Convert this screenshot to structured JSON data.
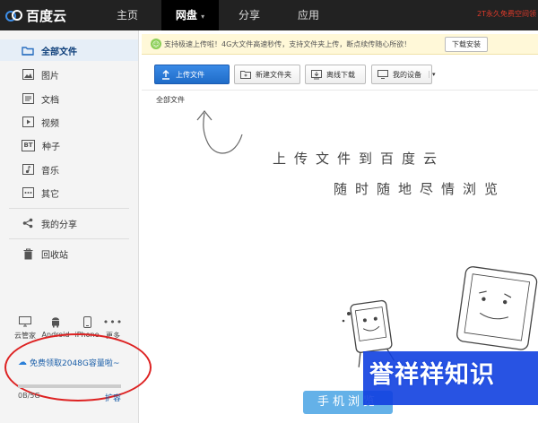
{
  "header": {
    "logo_text": "百度云",
    "nav": [
      {
        "label": "主页"
      },
      {
        "label": "网盘"
      },
      {
        "label": "分享"
      },
      {
        "label": "应用"
      }
    ],
    "promo": "2T永久免费空间领"
  },
  "sidebar": {
    "items": [
      {
        "label": "全部文件",
        "icon": "folder-icon"
      },
      {
        "label": "图片",
        "icon": "image-icon"
      },
      {
        "label": "文档",
        "icon": "document-icon"
      },
      {
        "label": "视频",
        "icon": "video-icon"
      },
      {
        "label": "种子",
        "icon": "bt-icon"
      },
      {
        "label": "音乐",
        "icon": "music-icon"
      },
      {
        "label": "其它",
        "icon": "more-icon"
      },
      {
        "label": "我的分享",
        "icon": "share-icon"
      },
      {
        "label": "回收站",
        "icon": "trash-icon"
      }
    ],
    "devices": [
      {
        "label": "云管家"
      },
      {
        "label": "Android"
      },
      {
        "label": "iPhone"
      },
      {
        "label": "更多"
      }
    ],
    "claim": "免费领取2048G容量啦~",
    "quota_text": "0B/5G",
    "quota_fraction": 0,
    "expand": "扩容"
  },
  "notice": {
    "text": "支持极速上传啦！4G大文件高速秒传，支持文件夹上传，断点续传随心所欲！",
    "download_button": "下载安装"
  },
  "toolbar": {
    "upload": "上传文件",
    "new_folder": "新建文件夹",
    "offline": "离线下载",
    "devices": "我的设备"
  },
  "breadcrumb": "全部文件",
  "empty_state": {
    "line1": "上传文件到百度云",
    "line2": "随时随地尽情浏览",
    "mobile_button": "手机浏览"
  },
  "watermark": "誉祥祥知识",
  "colors": {
    "topbar": "#222222",
    "accent": "#1f6cc8",
    "highlight_circle": "#dd2222"
  }
}
